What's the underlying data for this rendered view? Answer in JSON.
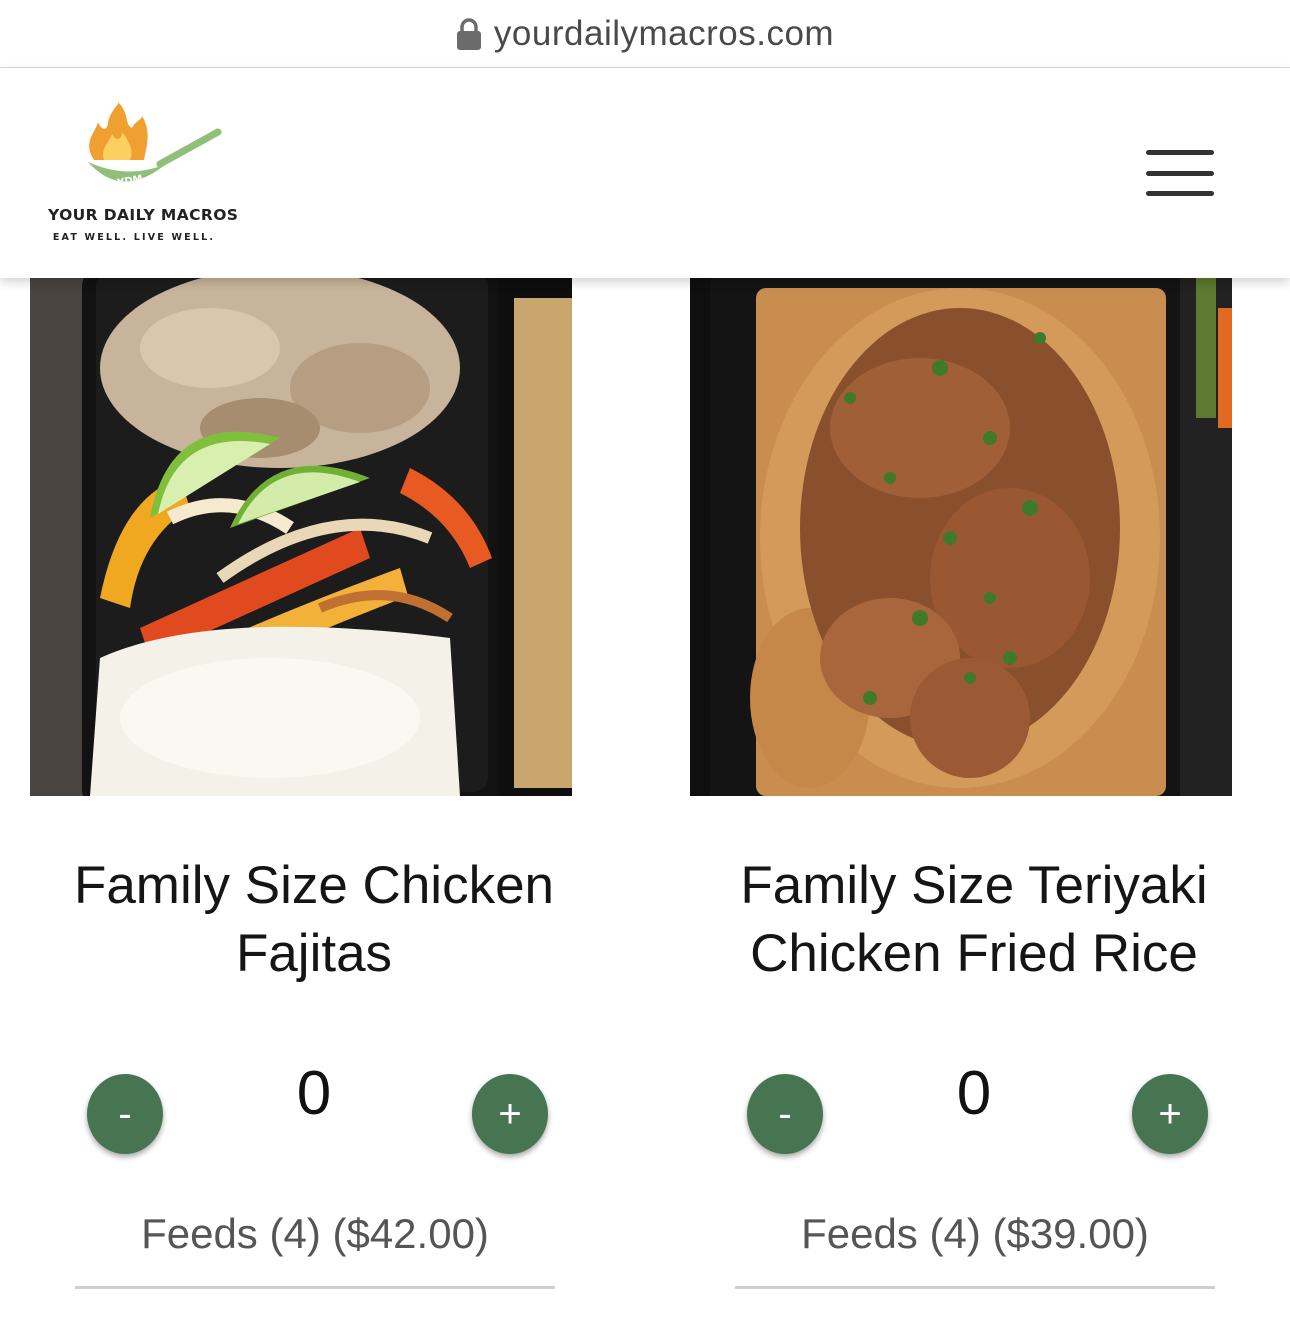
{
  "browser": {
    "url": "yourdailymacros.com"
  },
  "header": {
    "logo_badge": "YDM",
    "logo_title": "YOUR DAILY MACROS",
    "logo_tagline": "EAT WELL. LIVE WELL."
  },
  "products": [
    {
      "name": "Family Size Chicken Fajitas",
      "quantity": "0",
      "decrement_label": "-",
      "increment_label": "+",
      "feeds": "Feeds (4) ($42.00)"
    },
    {
      "name": "Family Size Teriyaki Chicken Fried Rice",
      "quantity": "0",
      "decrement_label": "-",
      "increment_label": "+",
      "feeds": "Feeds (4) ($39.00)"
    }
  ],
  "colors": {
    "button_green": "#477552",
    "logo_pan_green": "#8fc079",
    "logo_flame": "#f0a030"
  }
}
